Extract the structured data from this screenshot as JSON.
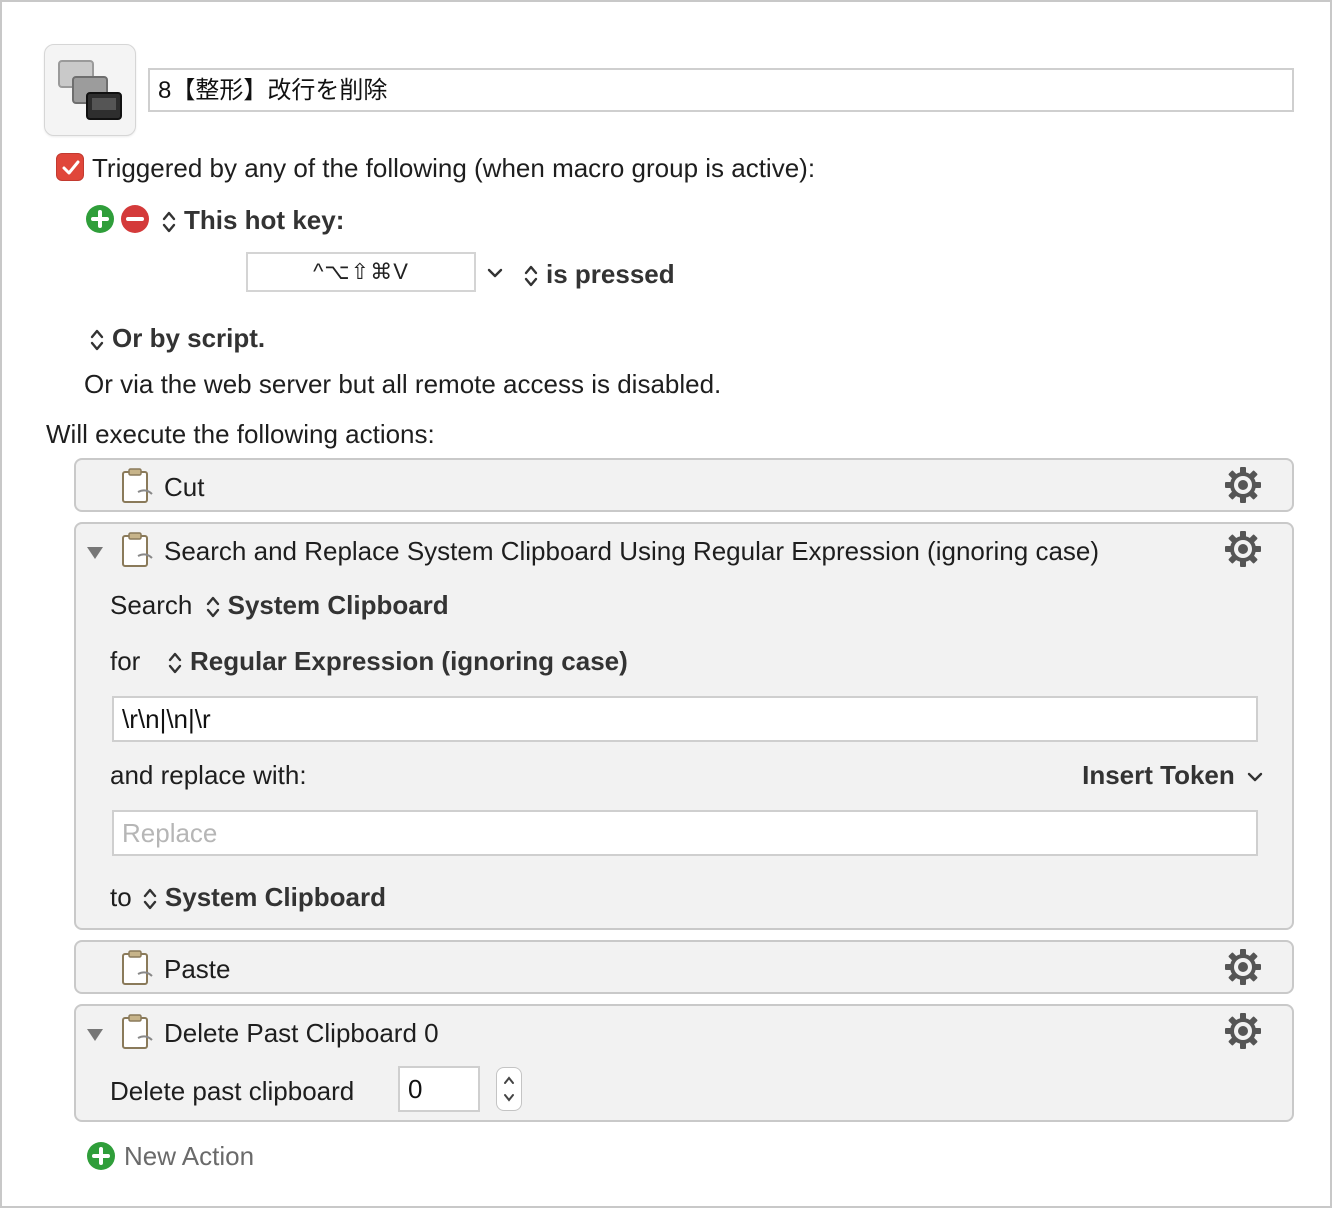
{
  "macro": {
    "title": "8【整形】改行を削除"
  },
  "trigger": {
    "header": "Triggered by any of the following (when macro group is active):",
    "hotkey_type": "This hot key:",
    "hotkey": "^⌥⇧⌘V",
    "hotkey_condition": "is pressed",
    "script_option": "Or by script.",
    "web_server_note": "Or via the web server but all remote access is disabled."
  },
  "actions_header": "Will execute the following actions:",
  "actions": {
    "cut": {
      "title": "Cut"
    },
    "search_replace": {
      "title": "Search and Replace System Clipboard Using Regular Expression (ignoring case)",
      "search_label": "Search",
      "search_source": "System Clipboard",
      "for_label": "for",
      "match_mode": "Regular Expression (ignoring case)",
      "pattern": "\\r\\n|\\n|\\r",
      "replace_label": "and replace with:",
      "insert_token": "Insert Token",
      "replace_placeholder": "Replace",
      "to_label": "to",
      "destination": "System Clipboard"
    },
    "paste": {
      "title": "Paste"
    },
    "delete_past": {
      "title": "Delete Past Clipboard 0",
      "label": "Delete past clipboard",
      "value": "0"
    }
  },
  "new_action": "New Action",
  "colors": {
    "checkbox": "#e0463a",
    "add_green": "#2f9e3a",
    "remove_red": "#d43a3a",
    "panel_bg": "#f2f2f2"
  },
  "icons": [
    "macro-icon",
    "checkbox-icon",
    "add-icon",
    "remove-icon",
    "updown-icon",
    "chevron-down-icon",
    "clipboard-icon",
    "gear-icon",
    "disclosure-triangle-icon",
    "stepper-icon"
  ]
}
